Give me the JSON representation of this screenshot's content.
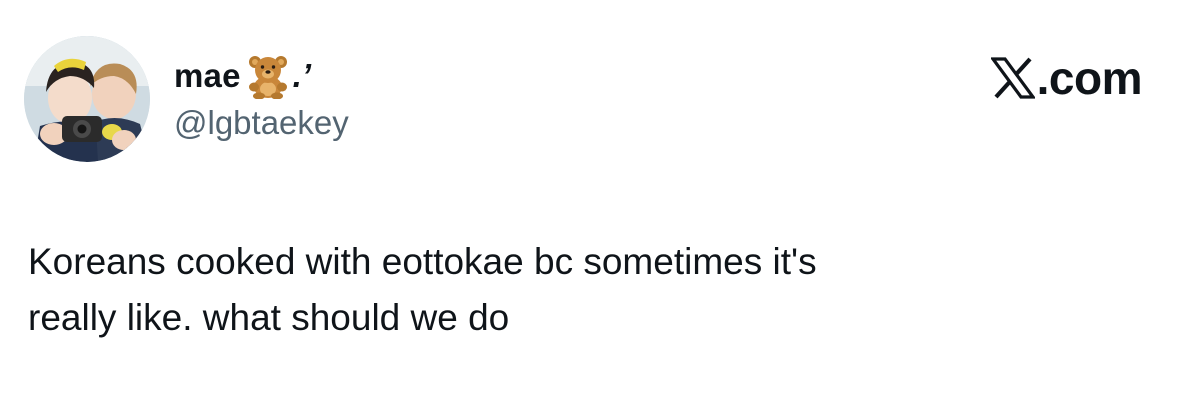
{
  "author": {
    "display_name": "mae",
    "name_emoji": "teddy-bear",
    "name_suffix": ".’",
    "handle": "@lgbtaekey",
    "avatar": "photo-two-people-with-camera"
  },
  "site": {
    "logo_icon": "x-logo-icon",
    "domain": ".com"
  },
  "tweet": {
    "text": "Koreans cooked with eottokae bc sometimes it's\nreally like. what should we do"
  },
  "colors": {
    "text": "#0f1419",
    "secondary_text": "#536471",
    "background": "#ffffff"
  }
}
